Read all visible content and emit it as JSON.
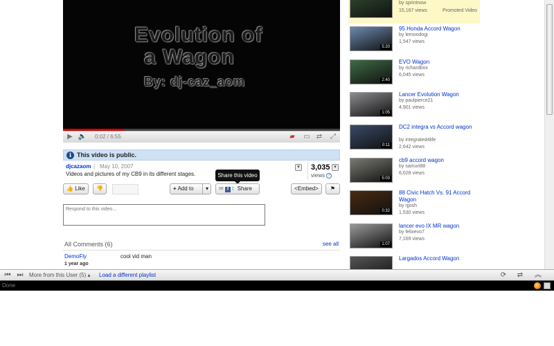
{
  "video": {
    "overlay_line1": "Evolution of",
    "overlay_line2": "a Wagon",
    "overlay_line3": "By: dj-caz_aom",
    "time_display": "0:02 / 6:55",
    "progress_fraction": 0.22
  },
  "info": {
    "public_notice": "This video is public.",
    "uploader": "djcazaom",
    "separator": "|",
    "upload_date": "May 10, 2007",
    "description": "Videos and pictures of my CB9 in its different stages.",
    "view_count": "3,035",
    "views_label": "views"
  },
  "actions": {
    "like_label": "Like",
    "addto_label": "Add to",
    "share_label": "Share",
    "share_tooltip": "Share this video",
    "embed_label": "<Embed>"
  },
  "comment_input": {
    "placeholder": "Respond to this video..."
  },
  "comments": {
    "title": "All Comments (6)",
    "see_all": "see all",
    "items": [
      {
        "author": "DemoFly",
        "age": "1 year ago",
        "text": "cool vid man"
      }
    ]
  },
  "related": [
    {
      "title": "",
      "by": "by sprintnow",
      "views": "15,167 views",
      "duration": "",
      "promo": "Promoted Video",
      "thumb_color": "#2f4a2f"
    },
    {
      "title": "95 Honda Accord Wagon",
      "by": "by lemondogi",
      "views": "1,547 views",
      "duration": "5:20",
      "thumb_color": "#6c8ab0"
    },
    {
      "title": "EVO Wagon",
      "by": "by richardbox",
      "views": "6,045 views",
      "duration": "2:40",
      "thumb_color": "#3e6b46"
    },
    {
      "title": "Lancer Evolution Wagon",
      "by": "by paulpierce21",
      "views": "4,901 views",
      "duration": "1:05",
      "thumb_color": "#8c8c90"
    },
    {
      "title": "DC2 integra vs Accord wagon",
      "by": "by integrated4life",
      "views": "2,642 views",
      "duration": "0:11",
      "thumb_color": "#3a4a66"
    },
    {
      "title": "cb9 accord wagon",
      "by": "by samuri88",
      "views": "6,028 views",
      "duration": "5:03",
      "thumb_color": "#7a7a74"
    },
    {
      "title": "88 Civic Hatch Vs. 91 Accord Wagon",
      "by": "by rjjosh",
      "views": "1,530 views",
      "duration": "0:32",
      "thumb_color": "#4a2a12"
    },
    {
      "title": "lancer evo IX MR wagon",
      "by": "by felixevo7",
      "views": "7,169 views",
      "duration": "1:07",
      "thumb_color": "#9a9a9a"
    },
    {
      "title": "Largados Accord Wagon",
      "by": "",
      "views": "",
      "duration": "",
      "thumb_color": "#555"
    }
  ],
  "playlist_bar": {
    "more_from": "More from this User (5) ▴",
    "load_playlist": "Load a different playlist"
  },
  "status_bar": {
    "text": "Done"
  }
}
